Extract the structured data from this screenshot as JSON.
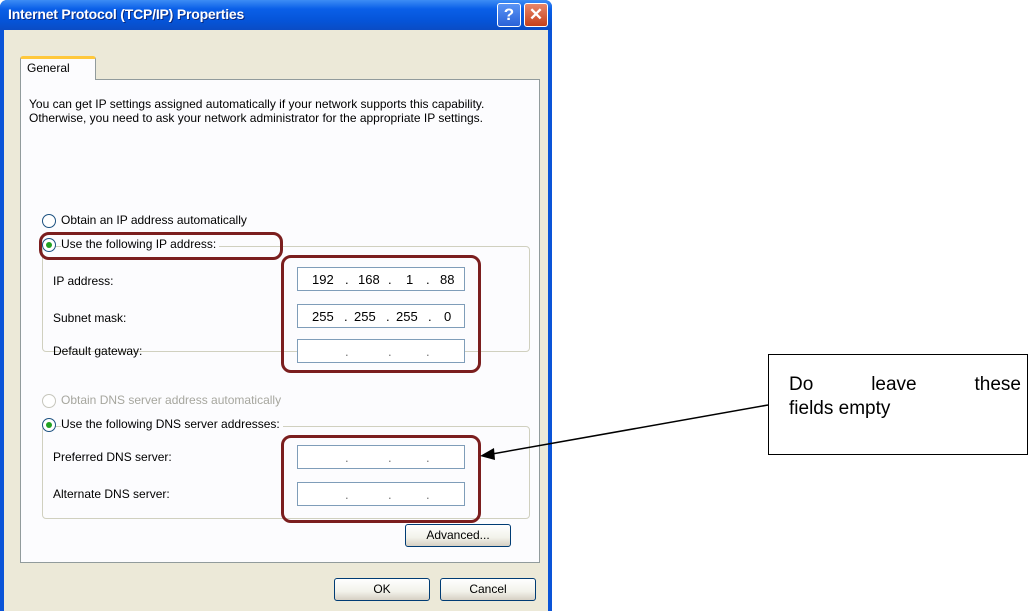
{
  "window": {
    "title": "Internet Protocol (TCP/IP) Properties",
    "help_label": "?",
    "close_label": "✕"
  },
  "tabs": [
    {
      "label": "General"
    }
  ],
  "general": {
    "description": "You can get IP settings assigned automatically if your network supports this capability. Otherwise, you need to ask your network administrator for the appropriate IP settings.",
    "ip_mode": {
      "auto_label": "Obtain an IP address automatically",
      "manual_label": "Use the following IP address:",
      "selected": "manual"
    },
    "ip_fields": {
      "ip_address": {
        "label": "IP address:",
        "octets": [
          "192",
          "168",
          "1",
          "88"
        ]
      },
      "subnet_mask": {
        "label": "Subnet mask:",
        "octets": [
          "255",
          "255",
          "255",
          "0"
        ]
      },
      "default_gateway": {
        "label": "Default gateway:",
        "octets": [
          "",
          "",
          "",
          ""
        ]
      }
    },
    "dns_mode": {
      "auto_label": "Obtain DNS server address automatically",
      "manual_label": "Use the following DNS server addresses:",
      "selected": "manual",
      "auto_disabled": true
    },
    "dns_fields": {
      "preferred": {
        "label": "Preferred DNS server:",
        "octets": [
          "",
          "",
          "",
          ""
        ]
      },
      "alternate": {
        "label": "Alternate DNS server:",
        "octets": [
          "",
          "",
          "",
          ""
        ]
      }
    },
    "advanced_label": "Advanced..."
  },
  "footer": {
    "ok_label": "OK",
    "cancel_label": "Cancel"
  },
  "annotation": {
    "callout_line1_words": [
      "Do",
      "leave",
      "these"
    ],
    "callout_line2": "fields empty",
    "highlight_color": "#7b1e1e"
  }
}
